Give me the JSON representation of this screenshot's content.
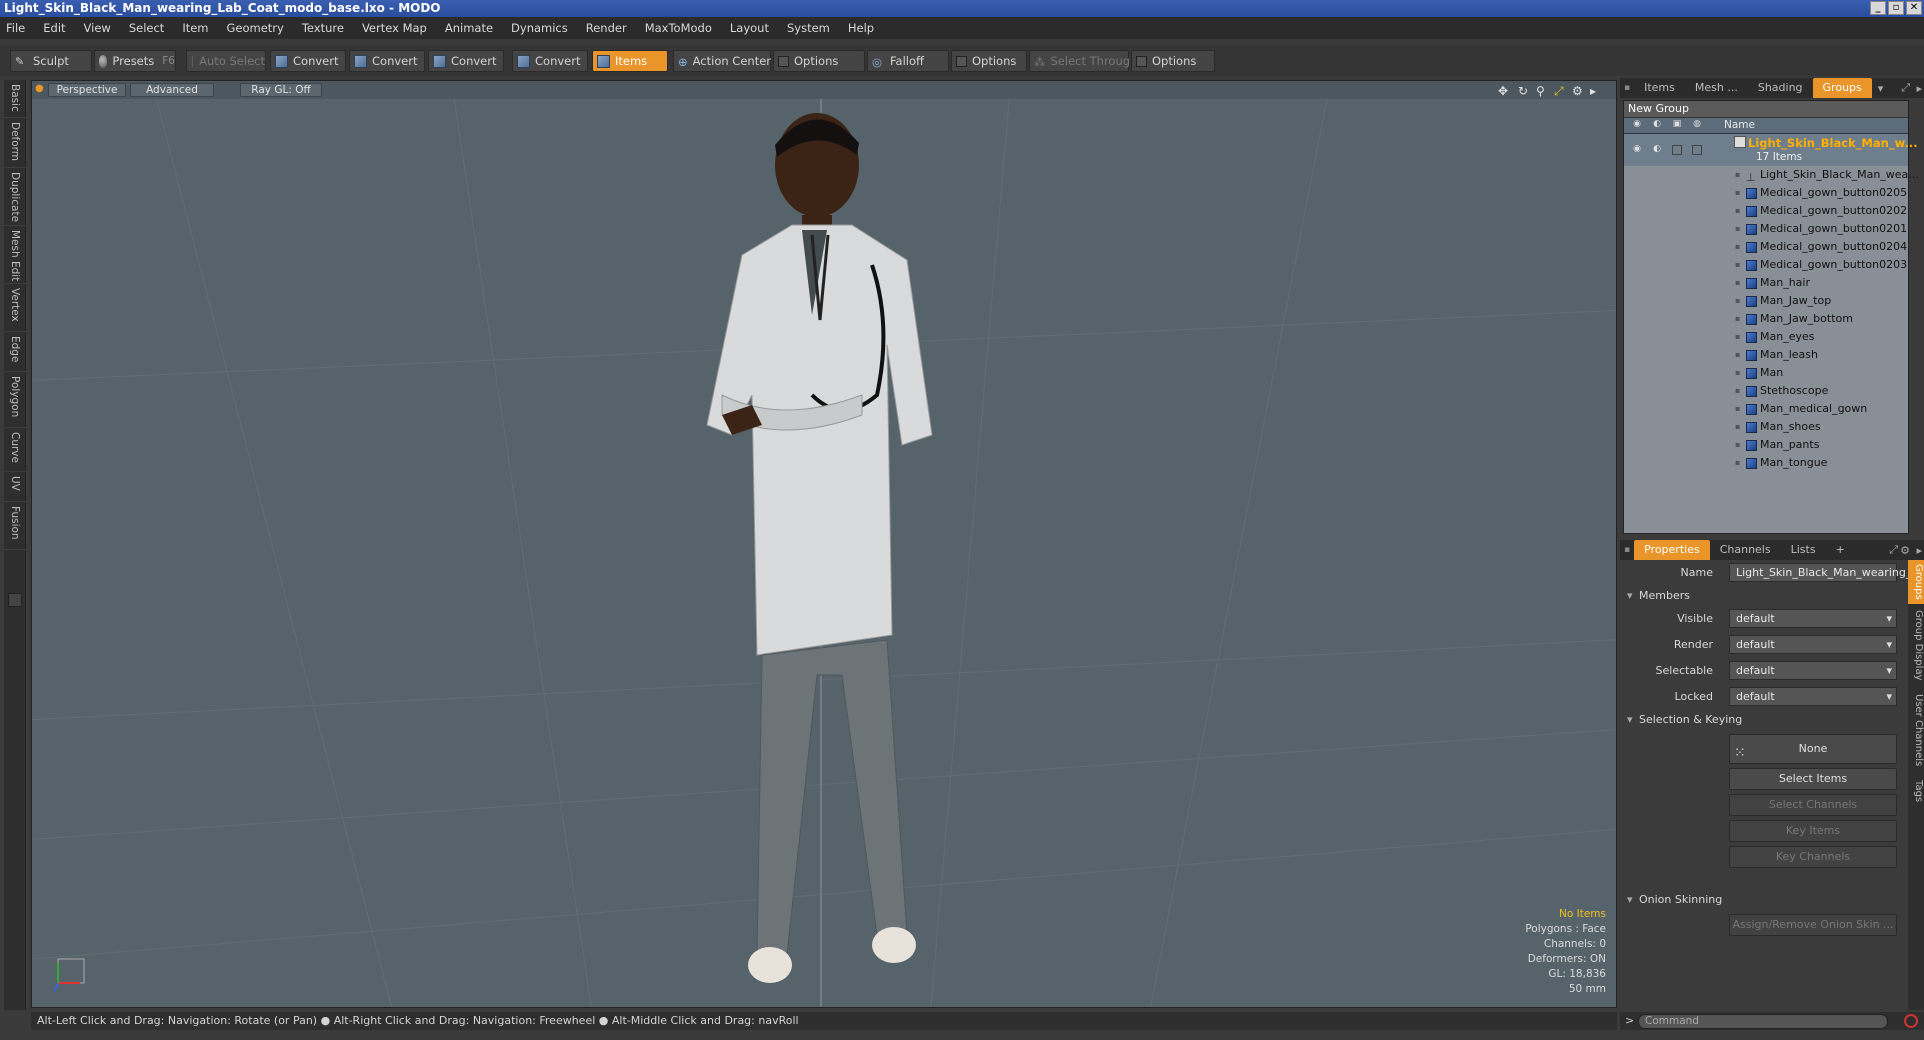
{
  "window": {
    "title": "Light_Skin_Black_Man_wearing_Lab_Coat_modo_base.lxo - MODO",
    "controls": [
      "_",
      "▫",
      "✕"
    ]
  },
  "menu": [
    "File",
    "Edit",
    "View",
    "Select",
    "Item",
    "Geometry",
    "Texture",
    "Vertex Map",
    "Animate",
    "Dynamics",
    "Render",
    "MaxToModo",
    "Layout",
    "System",
    "Help"
  ],
  "toolbar": {
    "sculpt": "Sculpt",
    "presets": "Presets",
    "presets_key": "F6",
    "auto_select": "Auto Select",
    "convert1": "Convert",
    "convert2": "Convert",
    "convert3": "Convert",
    "convert4": "Convert",
    "items": "Items",
    "action_center": "Action Center",
    "options1": "Options",
    "falloff": "Falloff",
    "options2": "Options",
    "select_through": "Select Through",
    "options3": "Options"
  },
  "left_tabs": [
    "Basic",
    "Deform",
    "Duplicate",
    "Mesh Edit",
    "Vertex",
    "Edge",
    "Polygon",
    "Curve",
    "UV",
    "Fusion"
  ],
  "viewport": {
    "view": "Perspective",
    "shading": "Advanced",
    "raygl": "Ray GL: Off",
    "stats": {
      "no_items": "No Items",
      "polygons": "Polygons : Face",
      "channels": "Channels: 0",
      "deformers": "Deformers: ON",
      "gl": "GL: 18,836",
      "focal": "50 mm"
    }
  },
  "status": "Alt-Left Click and Drag: Navigation: Rotate (or Pan) ● Alt-Right Click and Drag: Navigation: Freewheel ● Alt-Middle Click and Drag: navRoll",
  "top_tabs": [
    "Items",
    "Mesh ...",
    "Shading",
    "Groups"
  ],
  "groups": {
    "new_group": "New Group",
    "col_name": "Name",
    "group_name": "Light_Skin_Black_Man_w...",
    "group_count": "17 Items",
    "items": [
      {
        "label": "Light_Skin_Black_Man_wea...",
        "type": "locator"
      },
      {
        "label": "Medical_gown_button0205",
        "type": "mesh"
      },
      {
        "label": "Medical_gown_button0202",
        "type": "mesh"
      },
      {
        "label": "Medical_gown_button0201",
        "type": "mesh"
      },
      {
        "label": "Medical_gown_button0204",
        "type": "mesh"
      },
      {
        "label": "Medical_gown_button0203",
        "type": "mesh"
      },
      {
        "label": "Man_hair",
        "type": "mesh"
      },
      {
        "label": "Man_Jaw_top",
        "type": "mesh"
      },
      {
        "label": "Man_Jaw_bottom",
        "type": "mesh"
      },
      {
        "label": "Man_eyes",
        "type": "mesh"
      },
      {
        "label": "Man_leash",
        "type": "mesh"
      },
      {
        "label": "Man",
        "type": "mesh"
      },
      {
        "label": "Stethoscope",
        "type": "mesh"
      },
      {
        "label": "Man_medical_gown",
        "type": "mesh"
      },
      {
        "label": "Man_shoes",
        "type": "mesh"
      },
      {
        "label": "Man_pants",
        "type": "mesh"
      },
      {
        "label": "Man_tongue",
        "type": "mesh"
      }
    ]
  },
  "prop_tabs": [
    "Properties",
    "Channels",
    "Lists",
    "+"
  ],
  "properties": {
    "name_label": "Name",
    "name_value": "Light_Skin_Black_Man_wearing_l",
    "members": "Members",
    "visible_label": "Visible",
    "visible": "default",
    "render_label": "Render",
    "render": "default",
    "selectable_label": "Selectable",
    "selectable": "default",
    "locked_label": "Locked",
    "locked": "default",
    "sel_keying": "Selection & Keying",
    "none": "None",
    "select_items": "Select Items",
    "select_channels": "Select Channels",
    "key_items": "Key Items",
    "key_channels": "Key Channels",
    "onion": "Onion Skinning",
    "assign_onion": "Assign/Remove Onion Skin ..."
  },
  "right_vtabs": [
    "Groups",
    "Group Display",
    "User Channels",
    "Tags"
  ],
  "command_placeholder": "Command"
}
